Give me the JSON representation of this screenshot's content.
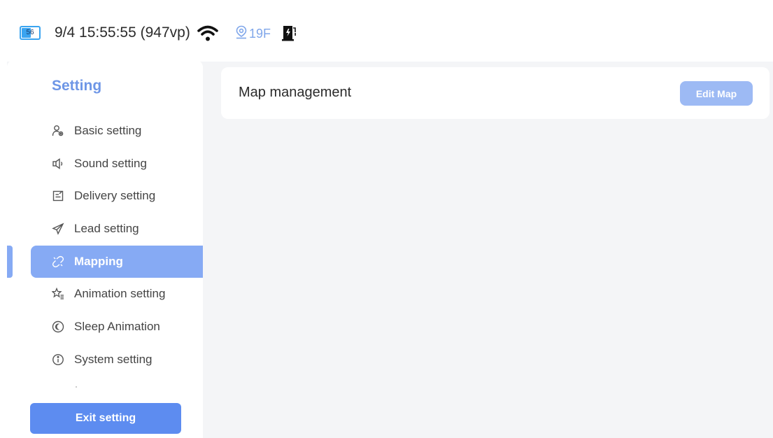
{
  "status_bar": {
    "battery_level": "56",
    "battery_fraction": 0.56,
    "clock": "9/4 15:55:55 (947vp)",
    "wifi_icon": "wifi-icon",
    "floor": "19F",
    "floor_icon": "location-pin-icon",
    "charging_icon": "charging-station-icon"
  },
  "colors": {
    "accent": "#5d8cf0",
    "active_item": "#86aaf4",
    "title_blue": "#6e96e6",
    "edit_button": "#9dbaf4",
    "battery": "#3aa4f0"
  },
  "sidebar": {
    "title": "Setting",
    "items": [
      {
        "label": "Basic setting",
        "icon": "user-gear-icon",
        "active": false
      },
      {
        "label": "Sound setting",
        "icon": "speaker-icon",
        "active": false
      },
      {
        "label": "Delivery setting",
        "icon": "clipboard-edit-icon",
        "active": false
      },
      {
        "label": "Lead setting",
        "icon": "send-icon",
        "active": false
      },
      {
        "label": "Mapping",
        "icon": "mapping-icon",
        "active": true
      },
      {
        "label": "Animation setting",
        "icon": "stars-icon",
        "active": false
      },
      {
        "label": "Sleep Animation",
        "icon": "moon-icon",
        "active": false
      },
      {
        "label": "System setting",
        "icon": "info-icon",
        "active": false
      }
    ],
    "exit_label": "Exit setting"
  },
  "content": {
    "title": "Map management",
    "edit_label": "Edit Map"
  }
}
